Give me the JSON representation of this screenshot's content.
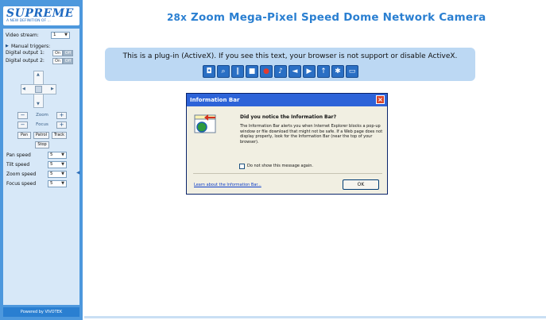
{
  "brand": {
    "logo": "SUPREME",
    "tagline": "A NEW DEFINITION OF ...",
    "powered": "Powered by VIVOTEK"
  },
  "page_title": {
    "prefix": "28x",
    "text": "Zoom Mega-Pixel Speed Dome Network Camera"
  },
  "sidebar": {
    "video_stream_label": "Video stream:",
    "video_stream_value": "1",
    "manual_triggers_label": "Manual triggers:",
    "digital_output_1_label": "Digital output 1:",
    "digital_output_2_label": "Digital output 2:",
    "toggle_on": "On",
    "toggle_off": "Off",
    "zoom_label": "Zoom",
    "focus_label": "Focus",
    "pan_button": "Pan",
    "patrol_button": "Patrol",
    "track_button": "Track",
    "stop_button": "Stop",
    "pan_speed_label": "Pan speed",
    "tilt_speed_label": "Tilt speed",
    "zoom_speed_label": "Zoom speed",
    "focus_speed_label": "Focus speed",
    "pan_speed_value": "5",
    "tilt_speed_value": "5",
    "zoom_speed_value": "5",
    "focus_speed_value": "5"
  },
  "viewer": {
    "activex_message": "This is a plug-in (ActiveX). If you see this text, your browser is not support or disable ActiveX.",
    "toolbar_icons": [
      "snapshot-icon",
      "zoom-icon",
      "pause-icon",
      "stop-icon",
      "record-icon",
      "volume-icon",
      "mute-icon",
      "talk-icon",
      "mic-icon",
      "ptz-icon",
      "fullscreen-icon"
    ]
  },
  "dialog": {
    "title": "Information Bar",
    "heading": "Did you notice the Information Bar?",
    "body": "The Information Bar alerts you when Internet Explorer blocks a pop-up window or file download that might not be safe. If a Web page does not display properly, look for the Information Bar (near the top of your browser).",
    "checkbox_label": "Do not show this message again.",
    "link": "Learn about the Information Bar...",
    "ok_label": "OK"
  },
  "colors": {
    "sidebar": "#4d98dd",
    "accent": "#2a7fd1",
    "dialog_title": "#2d63d8",
    "close": "#d9472b"
  }
}
